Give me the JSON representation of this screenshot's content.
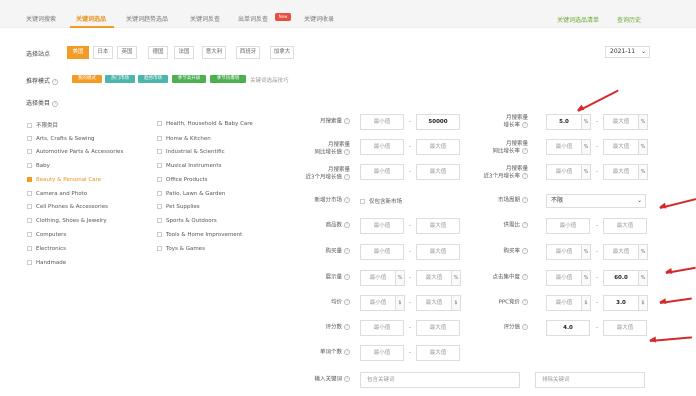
{
  "tabs": [
    "关键词搜索",
    "关键词选品",
    "关键词趋势选品",
    "关键词反查",
    "出单词反查",
    "关键词收录"
  ],
  "new_badge": "New",
  "right_links": [
    "关键词选品清单",
    "查询历史"
  ],
  "site": {
    "label": "选择站点",
    "options": [
      "美国",
      "日本",
      "英国",
      "德国",
      "法国",
      "意大利",
      "西班牙",
      "加拿大"
    ],
    "selected": "美国",
    "month": "2021-11"
  },
  "mode": {
    "label": "推荐模式",
    "tags": [
      {
        "text": "我的模式",
        "color": "#f29b25"
      },
      {
        "text": "热门市场",
        "color": "#4db6ac"
      },
      {
        "text": "趋势市场",
        "color": "#4db6ac"
      },
      {
        "text": "季节高升级",
        "color": "#4caf50"
      },
      {
        "text": "季节热爆增",
        "color": "#4caf50"
      }
    ],
    "tips": "关键词选品技巧"
  },
  "categories": {
    "label": "选择类目",
    "left": [
      "不限类目",
      "Arts, Crafts & Sewing",
      "Automotive Parts & Accessories",
      "Baby",
      "Beauty & Personal Care",
      "Camera and Photo",
      "Cell Phones & Accessories",
      "Clothing, Shoes & Jewelry",
      "Computers",
      "Electronics",
      "Handmade"
    ],
    "right": [
      "Health, Household & Baby Care",
      "Home & Kitchen",
      "Industrial & Scientific",
      "Musical Instruments",
      "Office Products",
      "Patio, Lawn & Garden",
      "Pet Supplies",
      "Sports & Outdoors",
      "Tools & Home Improvement",
      "Toys & Games"
    ],
    "selected": "Beauty & Personal Care"
  },
  "placeholders": {
    "min": "最小值",
    "max": "最大值"
  },
  "filters": {
    "monthly_search": {
      "label": "月搜索量",
      "min": "",
      "max": "50000"
    },
    "monthly_growth": {
      "label": "月搜索量\n增长率",
      "min": "5.0",
      "max": "",
      "unit": "%"
    },
    "yoy_growth": {
      "label": "月搜索量\n同比增长值",
      "min": "",
      "max": ""
    },
    "yoy_rate": {
      "label": "月搜索量\n同比增长率",
      "min": "",
      "max": ""
    },
    "three_month_growth": {
      "label": "月搜索量\n近3个月增长值",
      "min": "",
      "max": ""
    },
    "three_month_rate": {
      "label": "月搜索量\n近3个月增长率",
      "min": "",
      "max": ""
    },
    "new_market": {
      "label": "新增分市场",
      "checkbox": "仅包含新市场"
    },
    "market_cycle": {
      "label": "市场周期",
      "value": "不限"
    },
    "products": {
      "label": "商品数",
      "min": "",
      "max": ""
    },
    "supply_demand": {
      "label": "供需比",
      "min": "",
      "max": ""
    },
    "purchases": {
      "label": "购买量",
      "min": "",
      "max": ""
    },
    "purchase_rate": {
      "label": "购买率",
      "min": "",
      "max": ""
    },
    "impressions": {
      "label": "展示量",
      "min": "",
      "max": ""
    },
    "click_concentration": {
      "label": "点击集中度",
      "min": "",
      "max": "60.0",
      "unit": "%"
    },
    "price": {
      "label": "均价",
      "min": "",
      "max": "",
      "unit": "$"
    },
    "ppc": {
      "label": "PPC竞价",
      "min": "",
      "max": "3.0",
      "unit": "$"
    },
    "reviews": {
      "label": "评分数",
      "min": "",
      "max": ""
    },
    "rating": {
      "label": "评分值",
      "min": "4.0",
      "max": ""
    },
    "word_count": {
      "label": "单词个数",
      "min": "",
      "max": ""
    },
    "keyword_input": {
      "label": "输入关键词",
      "include": "包含关键词",
      "exclude": "排除关键词"
    }
  }
}
